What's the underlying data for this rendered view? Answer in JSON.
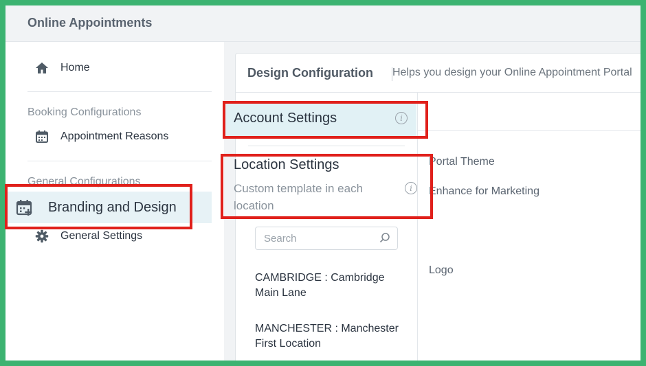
{
  "app": {
    "title": "Online Appointments"
  },
  "sidebar": {
    "home": "Home",
    "group_booking": "Booking Configurations",
    "appointment_reasons": "Appointment Reasons",
    "group_general": "General Configurations",
    "branding": "Branding and Design",
    "general_settings": "General Settings"
  },
  "card": {
    "title": "Design Configuration",
    "subtitle": "Helps you design your Online Appointment Portal"
  },
  "left_panel": {
    "account_settings": "Account Settings",
    "location_settings": "Location Settings",
    "location_settings_sub": "Custom template in each location",
    "search_placeholder": "Search",
    "locations": [
      "CAMBRIDGE : Cambridge Main Lane",
      "MANCHESTER : Manchester First Location"
    ]
  },
  "right_panel": {
    "portal_theme": "Portal Theme",
    "enhance_marketing": "Enhance for Marketing",
    "logo": "Logo"
  },
  "colors": {
    "frame": "#3cb371",
    "highlight": "#e0201b",
    "active_bg": "#e7f2f6",
    "account_bg": "#e1f1f5"
  },
  "icons": [
    "home-icon",
    "calendar-icon",
    "calendar-plus-icon",
    "gear-icon",
    "info-icon",
    "search-icon"
  ]
}
